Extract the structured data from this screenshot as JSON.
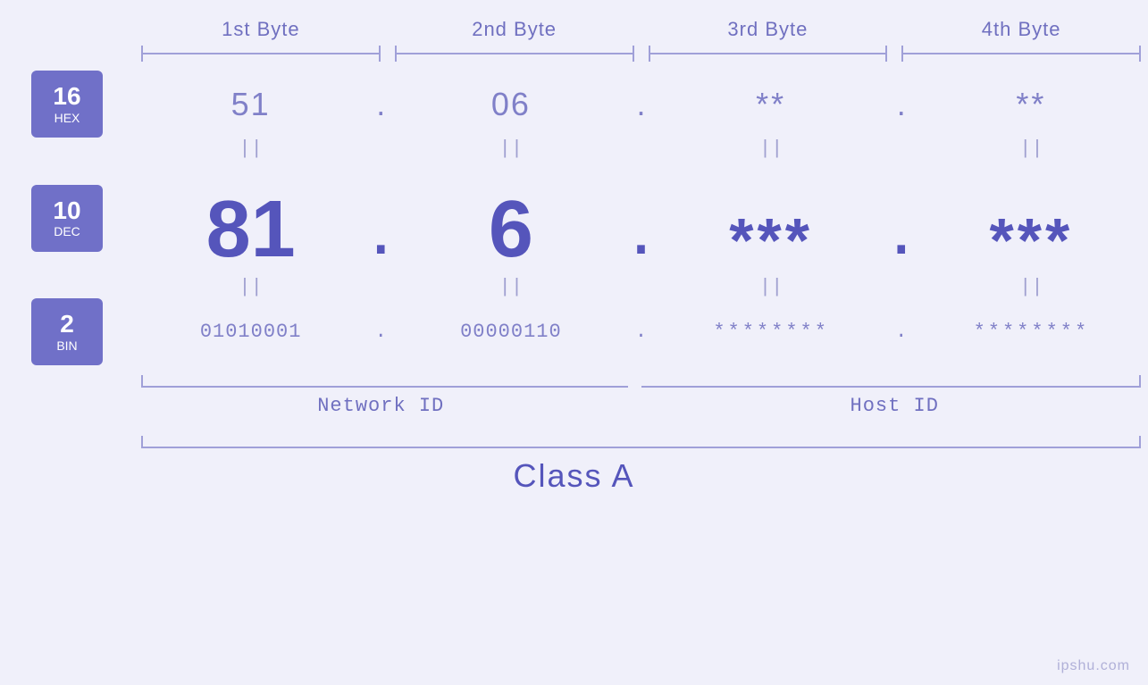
{
  "bytes": {
    "headers": [
      "1st Byte",
      "2nd Byte",
      "3rd Byte",
      "4th Byte"
    ]
  },
  "hex": {
    "label": "16",
    "base": "HEX",
    "values": [
      "51",
      "06",
      "**",
      "**"
    ],
    "dot": "."
  },
  "dec": {
    "label": "10",
    "base": "DEC",
    "values": [
      "81",
      "6",
      "***",
      "***"
    ],
    "dot": "."
  },
  "bin": {
    "label": "2",
    "base": "BIN",
    "values": [
      "01010001",
      "00000110",
      "********",
      "********"
    ],
    "dot": "."
  },
  "equals_sign": "||",
  "network_id_label": "Network ID",
  "host_id_label": "Host ID",
  "class_label": "Class A",
  "watermark": "ipshu.com"
}
